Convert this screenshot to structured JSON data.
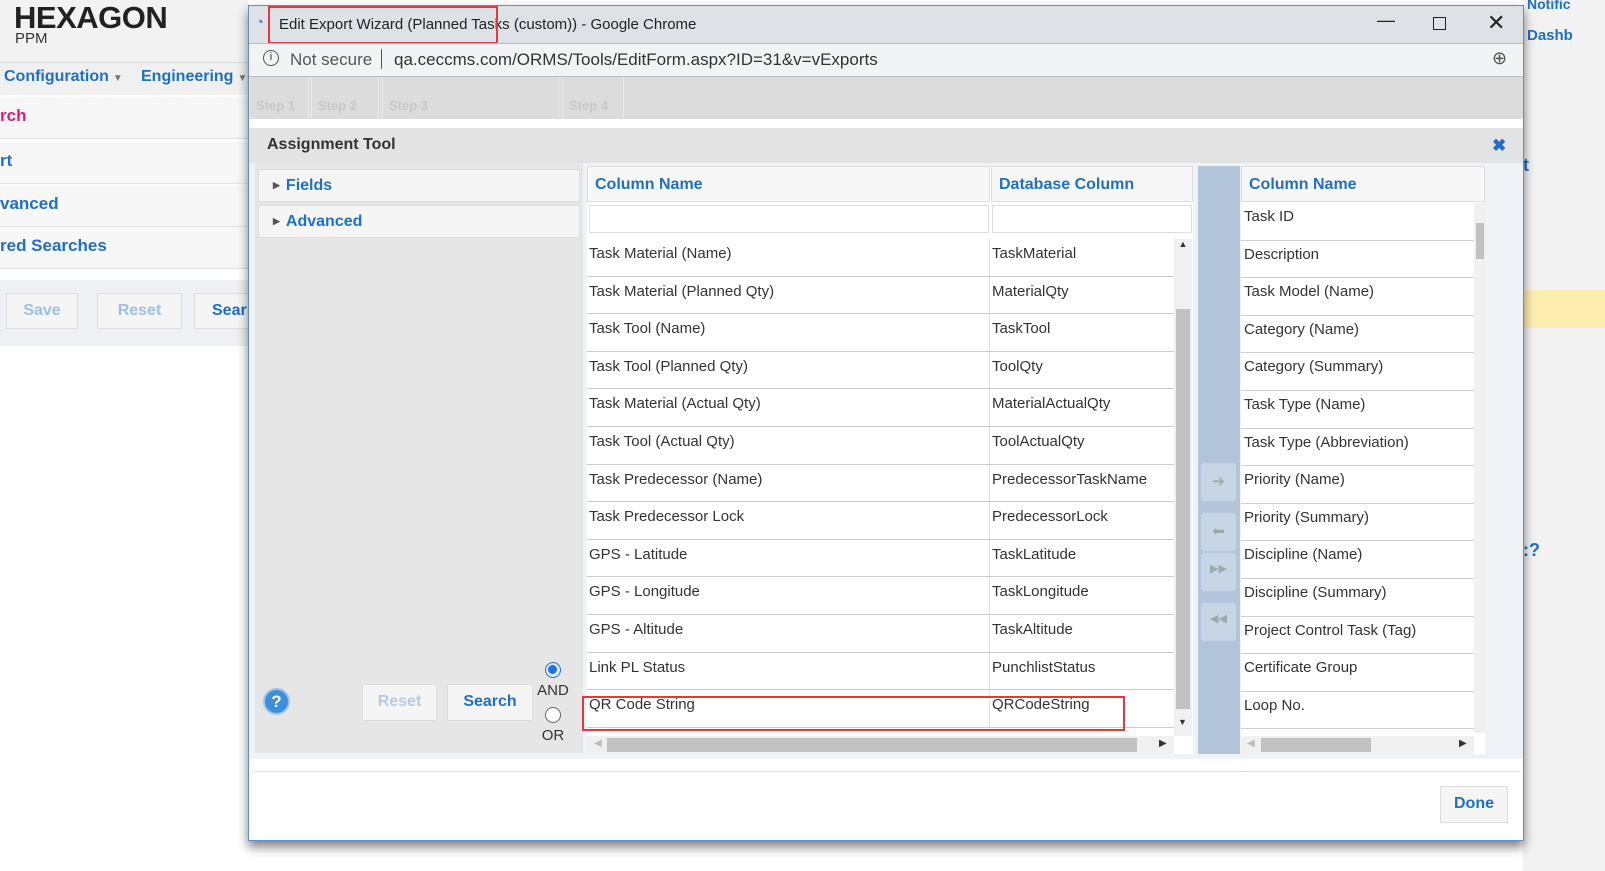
{
  "app": {
    "logo": "HEXAGON",
    "logo_sub": "PPM",
    "nav": [
      {
        "label": "Configuration"
      },
      {
        "label": "Engineering"
      }
    ],
    "left_items": [
      {
        "label": "rch"
      },
      {
        "label": "rt"
      },
      {
        "label": "vanced"
      },
      {
        "label": "red Searches"
      }
    ],
    "buttons": {
      "save": "Save",
      "reset": "Reset",
      "search": "Sear"
    },
    "right": {
      "notifications": "Notific",
      "dashboard": "Dashb",
      "t": "t",
      "q": ":?"
    }
  },
  "window": {
    "title": "Edit Export Wizard (Planned Tasks (custom)) - Google Chrome",
    "security": "Not secure",
    "url": "qa.ceccms.com/ORMS/Tools/EditForm.aspx?ID=31&v=vExports"
  },
  "steps": [
    "Step 1",
    "Step 2",
    "Step 3",
    "Step 4"
  ],
  "assignment": {
    "title": "Assignment Tool",
    "filters": [
      {
        "label": "Fields"
      },
      {
        "label": "Advanced"
      }
    ],
    "reset": "Reset",
    "search": "Search",
    "and": "AND",
    "or": "OR",
    "available": {
      "headers": [
        "Column Name",
        "Database Column"
      ],
      "rows": [
        [
          "Task Material (Name)",
          "TaskMaterial"
        ],
        [
          "Task Material (Planned Qty)",
          "MaterialQty"
        ],
        [
          "Task Tool (Name)",
          "TaskTool"
        ],
        [
          "Task Tool (Planned Qty)",
          "ToolQty"
        ],
        [
          "Task Material (Actual Qty)",
          "MaterialActualQty"
        ],
        [
          "Task Tool (Actual Qty)",
          "ToolActualQty"
        ],
        [
          "Task Predecessor (Name)",
          "PredecessorTaskName"
        ],
        [
          "Task Predecessor Lock",
          "PredecessorLock"
        ],
        [
          "GPS - Latitude",
          "TaskLatitude"
        ],
        [
          "GPS - Longitude",
          "TaskLongitude"
        ],
        [
          "GPS - Altitude",
          "TaskAltitude"
        ],
        [
          "Link PL Status",
          "PunchlistStatus"
        ],
        [
          "QR Code String",
          "QRCodeString"
        ]
      ]
    },
    "selected": {
      "header": "Column Name",
      "rows": [
        "Task ID",
        "Description",
        "Task Model (Name)",
        "Category (Name)",
        "Category (Summary)",
        "Task Type (Name)",
        "Task Type (Abbreviation)",
        "Priority (Name)",
        "Priority (Summary)",
        "Discipline (Name)",
        "Discipline (Summary)",
        "Project Control Task (Tag)",
        "Certificate Group",
        "Loop No."
      ]
    },
    "done": "Done"
  },
  "colors": {
    "accent": "#1f6fc5",
    "highlight": "#e0393e",
    "strip": "#b3c5da"
  }
}
